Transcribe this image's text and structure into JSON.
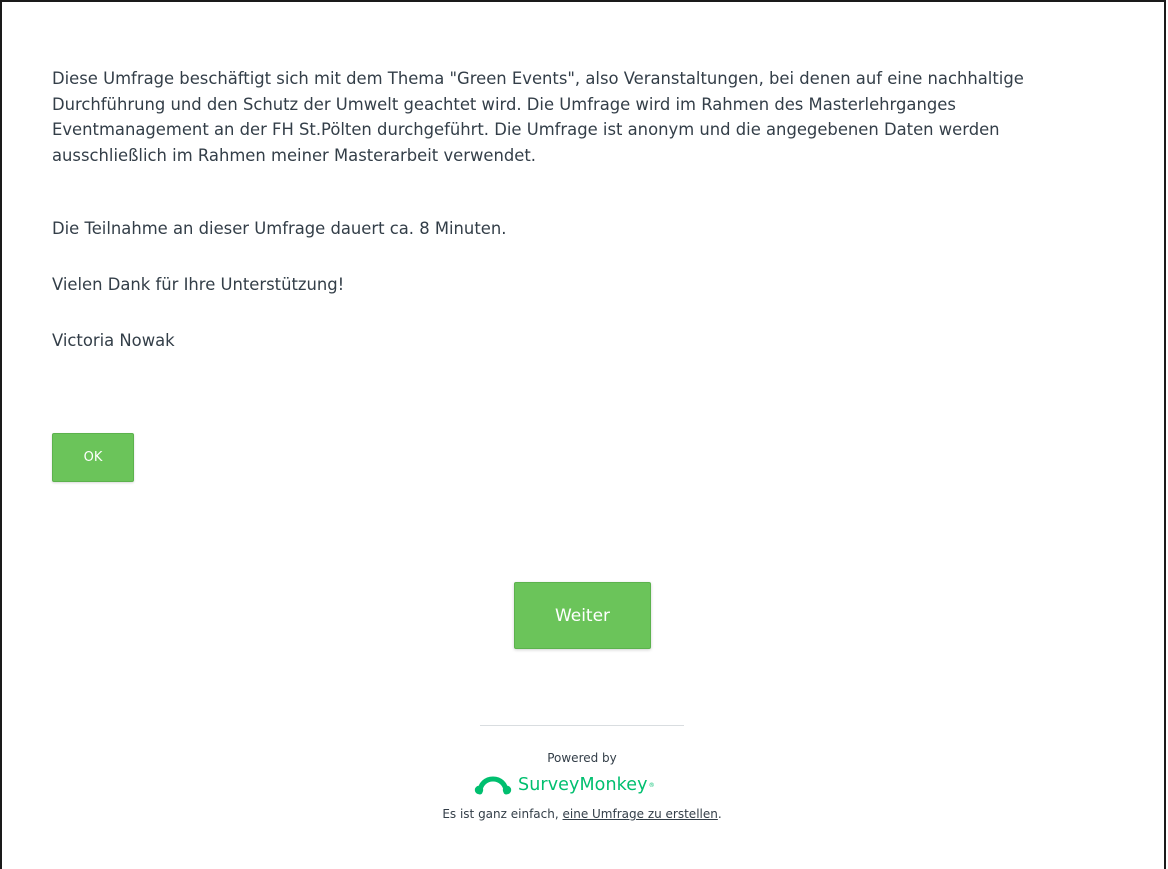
{
  "survey": {
    "intro_text": "Diese Umfrage beschäftigt sich mit dem Thema \"Green Events\", also Veranstaltungen, bei denen auf eine nachhaltige Durchführung und den Schutz der Umwelt geachtet wird. Die Umfrage wird im Rahmen des Masterlehrganges Eventmanagement an der FH St.Pölten durchgeführt. Die Umfrage ist anonym und die angegebenen Daten werden ausschließlich im Rahmen meiner Masterarbeit verwendet.",
    "duration_text": "Die Teilnahme an dieser Umfrage dauert ca. 8 Minuten.",
    "thanks_text": "Vielen Dank für Ihre Unterstützung!",
    "author": "Victoria Nowak",
    "ok_label": "OK",
    "next_label": "Weiter"
  },
  "footer": {
    "powered_by": "Powered by",
    "brand_name": "SurveyMonkey",
    "brand_tm": "®",
    "tagline_prefix": "Es ist ganz einfach, ",
    "tagline_link": "eine Umfrage zu erstellen",
    "tagline_suffix": "."
  },
  "colors": {
    "button_green": "#6bc45a",
    "brand_green": "#00bf6f",
    "text": "#333e48"
  },
  "icons": {
    "brand_logo": "surveymonkey-logo-icon"
  }
}
